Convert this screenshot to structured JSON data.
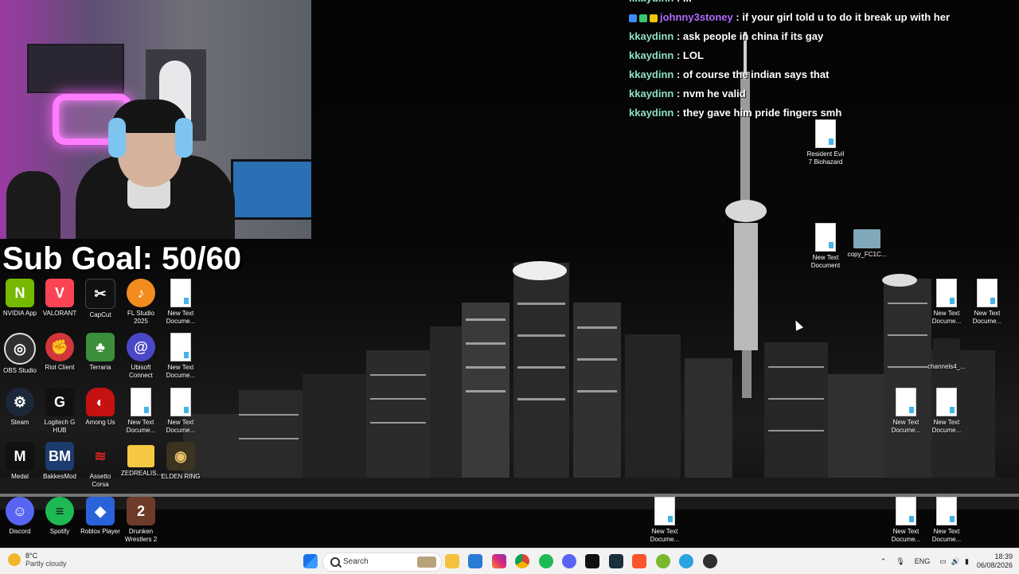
{
  "overlay": {
    "sub_goal": "Sub Goal: 50/60"
  },
  "chat": [
    {
      "user": "kkaydinn",
      "message": ": ..."
    },
    {
      "user": "johnny3stoney",
      "message": ": if your girl told u to do it break up with her"
    },
    {
      "user": "kkaydinn",
      "message": ": ask people in china if its gay"
    },
    {
      "user": "kkaydinn",
      "message": ": LOL"
    },
    {
      "user": "kkaydinn",
      "message": ": of course the indian says that"
    },
    {
      "user": "kkaydinn",
      "message": ": nvm he valid"
    },
    {
      "user": "kkaydinn",
      "message": ": they gave him pride fingers smh"
    }
  ],
  "desktop_icons": [
    {
      "label": "NVIDIA App",
      "icon": "nvidia-icon",
      "color": "#76b900"
    },
    {
      "label": "VALORANT",
      "icon": "valorant-icon",
      "color": "#fa4454"
    },
    {
      "label": "CapCut",
      "icon": "capcut-icon",
      "color": "#111111"
    },
    {
      "label": "FL Studio 2025",
      "icon": "fl-studio-icon",
      "color": "#f28c1e"
    },
    {
      "label": "New Text Docume...",
      "icon": "text-document-icon"
    },
    {
      "label": "OBS Studio",
      "icon": "obs-icon",
      "color": "#302e31"
    },
    {
      "label": "Riot Client",
      "icon": "riot-client-icon",
      "color": "#d13639"
    },
    {
      "label": "Terraria",
      "icon": "terraria-icon",
      "color": "#3c8f3a"
    },
    {
      "label": "Ubisoft Connect",
      "icon": "ubisoft-icon",
      "color": "#4a48c7"
    },
    {
      "label": "New Text Docume...",
      "icon": "text-document-icon"
    },
    {
      "label": "Steam",
      "icon": "steam-icon",
      "color": "#1b2838"
    },
    {
      "label": "Logitech G HUB",
      "icon": "logitech-icon",
      "color": "#111111"
    },
    {
      "label": "Among Us",
      "icon": "among-us-icon",
      "color": "#c51111"
    },
    {
      "label": "New Text Docume...",
      "icon": "text-document-icon"
    },
    {
      "label": "New Text Docume...",
      "icon": "text-document-icon"
    },
    {
      "label": "Medal",
      "icon": "medal-icon",
      "color": "#111111"
    },
    {
      "label": "BakkesMod",
      "icon": "bakkesmod-icon",
      "color": "#1c3b6e"
    },
    {
      "label": "Assetto Corsa",
      "icon": "assetto-corsa-icon",
      "color": "#b01e2e"
    },
    {
      "label": "ZEDREALIS...",
      "icon": "folder-icon",
      "color": "#f5c842"
    },
    {
      "label": "ELDEN RING",
      "icon": "elden-ring-icon",
      "color": "#3b3320"
    },
    {
      "label": "Discord",
      "icon": "discord-icon",
      "color": "#5865f2"
    },
    {
      "label": "Spotify",
      "icon": "spotify-icon",
      "color": "#1db954"
    },
    {
      "label": "Roblox Player",
      "icon": "roblox-icon",
      "color": "#2a62d9"
    },
    {
      "label": "Drunken Wrestlers 2",
      "icon": "drunken-wrestlers-icon",
      "color": "#6e3b2a"
    },
    {
      "label": "Resident Evil 7 Biohazard",
      "icon": "text-document-icon"
    },
    {
      "label": "New Text Document",
      "icon": "text-document-icon"
    },
    {
      "label": "copy_FC1C...",
      "icon": "image-file-icon",
      "color": "#7fa9b8"
    },
    {
      "label": "New Text Docume...",
      "icon": "text-document-icon"
    },
    {
      "label": "New Text Docume...",
      "icon": "text-document-icon"
    },
    {
      "label": "channels4_...",
      "icon": "image-file-icon",
      "color": "#222222"
    },
    {
      "label": "New Text Docume...",
      "icon": "text-document-icon"
    },
    {
      "label": "New Text Docume...",
      "icon": "text-document-icon"
    },
    {
      "label": "New Text Docume...",
      "icon": "text-document-icon"
    },
    {
      "label": "New Text Docume...",
      "icon": "text-document-icon"
    },
    {
      "label": "New Text Docume...",
      "icon": "text-document-icon"
    }
  ],
  "taskbar": {
    "weather_temp": "8°C",
    "weather_desc": "Partly cloudy",
    "search_placeholder": "Search",
    "language": "ENG",
    "time": "18:39",
    "date": "06/08/2026",
    "apps": [
      "start-icon",
      "file-explorer-icon",
      "microsoft-store-icon",
      "instagram-icon",
      "chrome-icon",
      "spotify-icon",
      "discord-icon",
      "dc-icon",
      "v-icon",
      "brave-icon",
      "utorrent-icon",
      "telegram-icon",
      "obs-icon"
    ]
  }
}
